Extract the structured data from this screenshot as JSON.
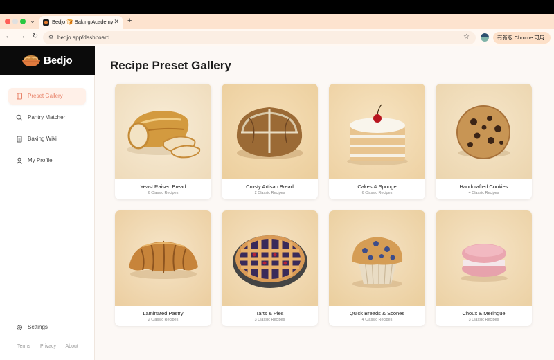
{
  "browser": {
    "tab_title": "Bedjo 🍞 Baking Academy",
    "url": "bedjo.app/dashboard",
    "update_button": "有新版 Chrome 可用"
  },
  "sidebar": {
    "brand": "Bedjo",
    "items": [
      {
        "label": "Preset Gallery",
        "icon": "book-icon",
        "active": true
      },
      {
        "label": "Pantry Matcher",
        "icon": "search-icon",
        "active": false
      },
      {
        "label": "Baking Wiki",
        "icon": "document-icon",
        "active": false
      },
      {
        "label": "My Profile",
        "icon": "user-icon",
        "active": false
      }
    ],
    "settings": "Settings",
    "footer": [
      "Terms",
      "Privacy",
      "About"
    ]
  },
  "main": {
    "title": "Recipe Preset Gallery",
    "cards": [
      {
        "title": "Yeast Raised Bread",
        "subtitle": "6 Classic Recipes"
      },
      {
        "title": "Crusty Artisan Bread",
        "subtitle": "2 Classic Recipes"
      },
      {
        "title": "Cakes & Sponge",
        "subtitle": "6 Classic Recipes"
      },
      {
        "title": "Handcrafted Cookies",
        "subtitle": "4 Classic Recipes"
      },
      {
        "title": "Laminated Pastry",
        "subtitle": "2 Classic Recipes"
      },
      {
        "title": "Tarts & Pies",
        "subtitle": "3 Classic Recipes"
      },
      {
        "title": "Quick Breads & Scones",
        "subtitle": "4 Classic Recipes"
      },
      {
        "title": "Choux & Meringue",
        "subtitle": "3 Classic Recipes"
      }
    ]
  },
  "colors": {
    "accent": "#e8836a",
    "tabstrip": "#fde3cf",
    "card_bg": "#f3e6d0"
  }
}
